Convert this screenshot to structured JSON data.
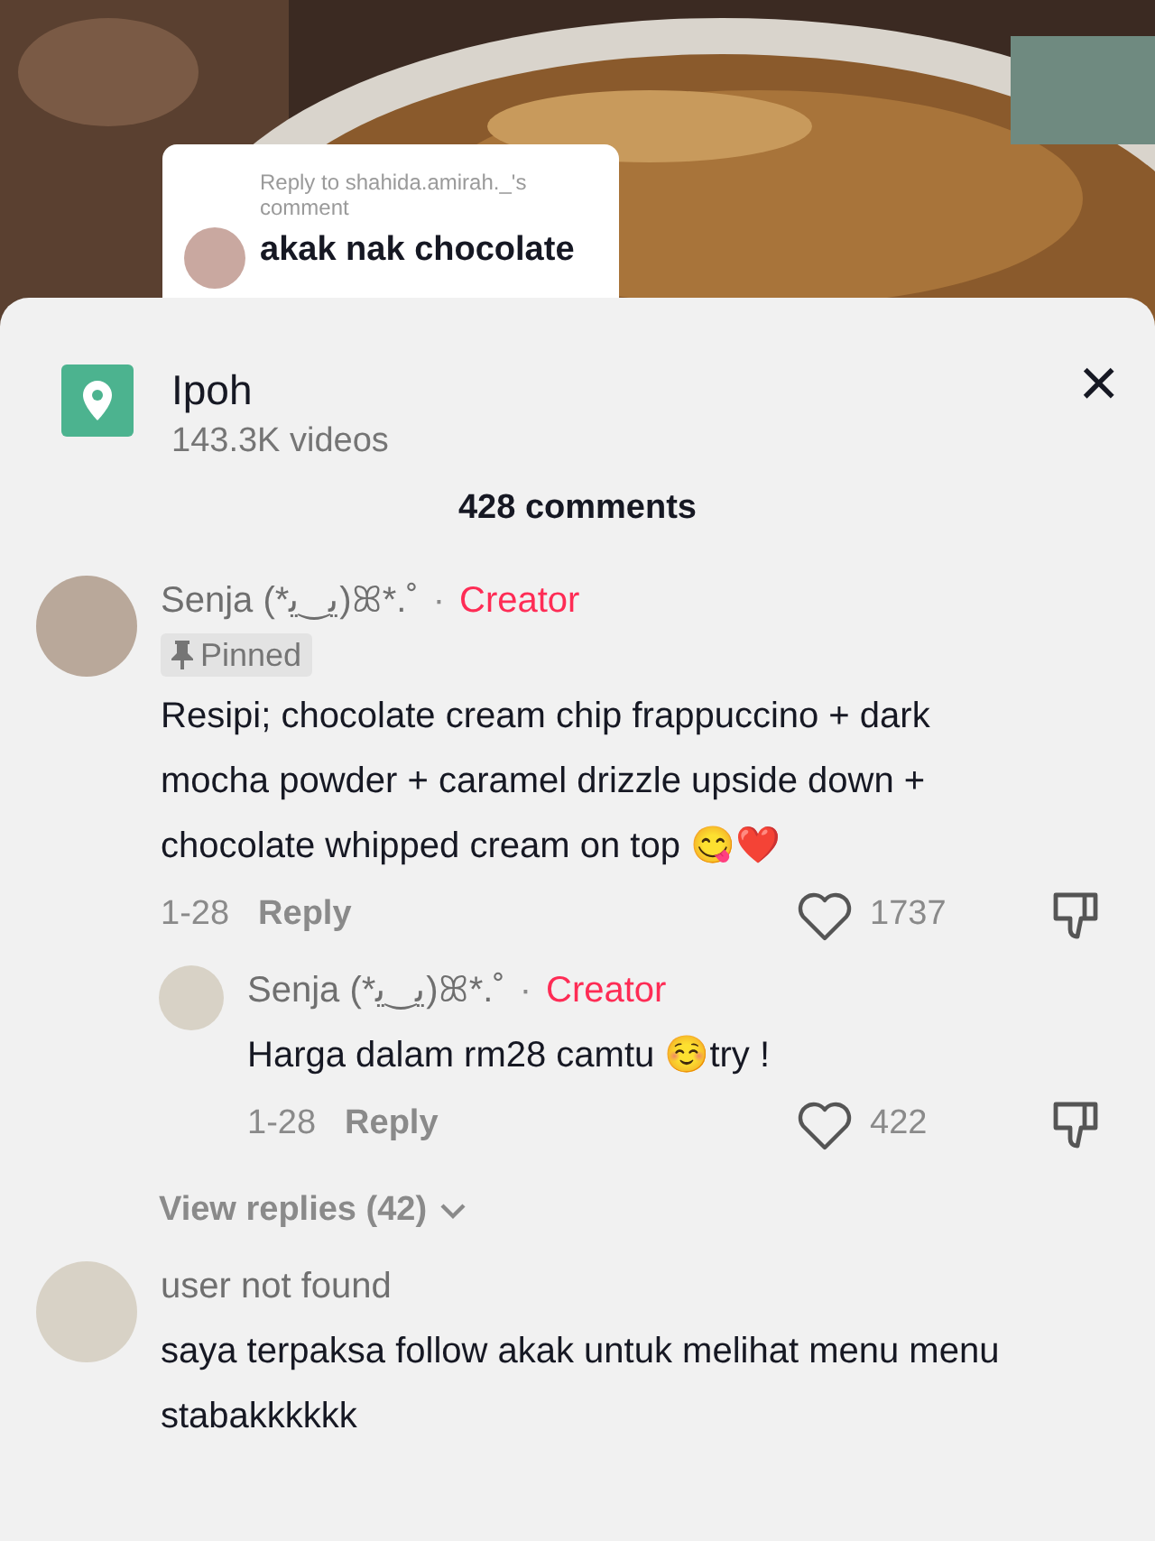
{
  "video_overlay": {
    "reply_to": "Reply to shahida.amirah._'s comment",
    "comment_lines": [
      "akak nak chocolate"
    ]
  },
  "header": {
    "title": "Ipoh",
    "subtitle": "143.3K videos",
    "close": "×"
  },
  "comment_count": "428 comments",
  "comments": [
    {
      "user": "Senja (*ﻳ‿ﻳ)ꕤ*.˚",
      "creator": true,
      "separator": "·",
      "creator_label": "Creator",
      "pinned": true,
      "pinned_label": "Pinned",
      "text": "Resipi; chocolate cream chip frappuccino + dark mocha powder + caramel drizzle upside down + chocolate whipped cream on top 😋❤️",
      "date": "1-28",
      "reply": "Reply",
      "likes": "1737",
      "replies": [
        {
          "user": "Senja (*ﻳ‿ﻳ)ꕤ*.˚",
          "creator": true,
          "separator": "·",
          "creator_label": "Creator",
          "pinned": false,
          "text": "Harga dalam rm28 camtu ☺️try !",
          "date": "1-28",
          "reply": "Reply",
          "likes": "422"
        }
      ],
      "view_replies": "View replies (42)"
    },
    {
      "user": "user not found",
      "creator": false,
      "pinned": false,
      "text": "saya terpaksa follow akak untuk melihat menu menu stabakkkkkk"
    }
  ]
}
